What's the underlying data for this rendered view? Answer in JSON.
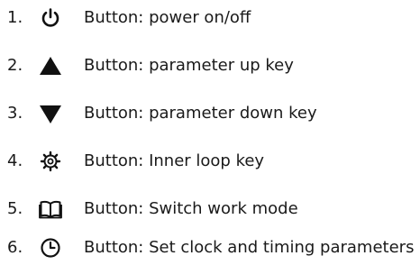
{
  "items": [
    {
      "number": "1.",
      "icon": "power-icon",
      "label": "Button: power on/off"
    },
    {
      "number": "2.",
      "icon": "triangle-up-icon",
      "label": "Button: parameter up key"
    },
    {
      "number": "3.",
      "icon": "triangle-down-icon",
      "label": "Button: parameter down key"
    },
    {
      "number": "4.",
      "icon": "gear-icon",
      "label": "Button: Inner loop key"
    },
    {
      "number": "5.",
      "icon": "book-icon",
      "label": "Button: Switch work mode"
    },
    {
      "number": "6.",
      "icon": "clock-icon",
      "label": "Button: Set clock and timing parameters"
    }
  ]
}
